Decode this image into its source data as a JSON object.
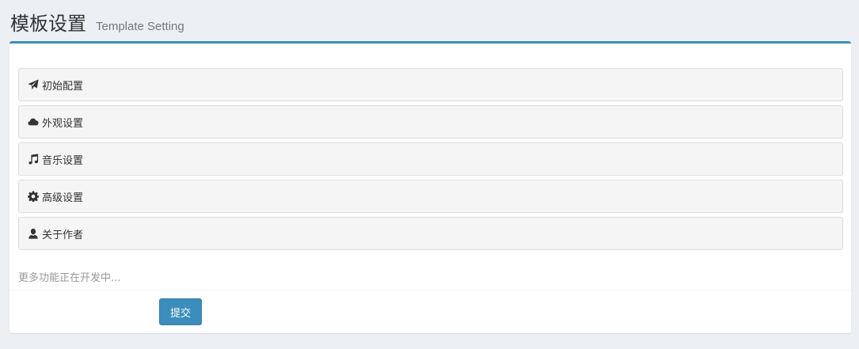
{
  "header": {
    "title": "模板设置",
    "subtitle": "Template Setting"
  },
  "panels": [
    {
      "icon": "paper-plane-icon",
      "label": "初始配置"
    },
    {
      "icon": "cloud-icon",
      "label": "外观设置"
    },
    {
      "icon": "music-icon",
      "label": "音乐设置"
    },
    {
      "icon": "gear-icon",
      "label": "高级设置"
    },
    {
      "icon": "user-icon",
      "label": "关于作者"
    }
  ],
  "more_text": "更多功能正在开发中...",
  "submit_label": "提交",
  "colors": {
    "accent": "#3c8dbc",
    "background": "#ecf0f5",
    "panel_bg": "#f5f5f5"
  }
}
